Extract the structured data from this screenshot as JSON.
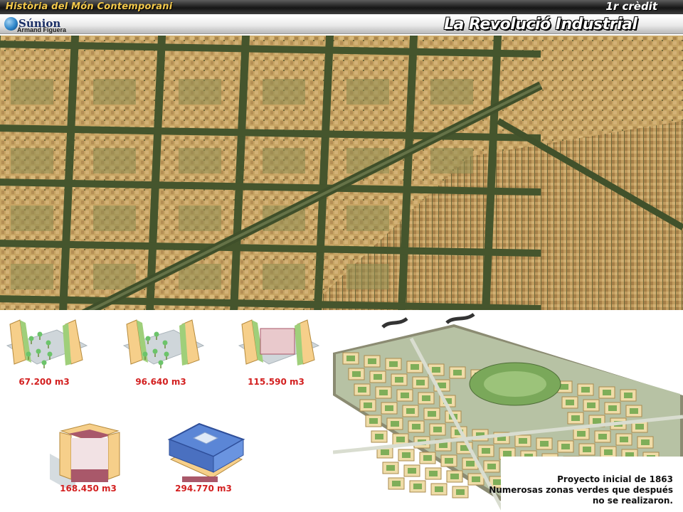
{
  "header": {
    "course_title": "Història del Món Contemporani",
    "credit": "1r crèdit",
    "lesson_title": "La Revolució Industrial",
    "logo": {
      "name": "Súnion",
      "author": "Armand Figuera",
      "icon": "globe-icon"
    }
  },
  "aerial_photo": {
    "subject": "aerial-view-city-grid",
    "colors": {
      "roofs": "#c8a765",
      "streets": "#4a5a30"
    }
  },
  "volume_diagram": {
    "blocks": [
      {
        "label": "67.200 m3",
        "type": "two-sides-garden"
      },
      {
        "label": "96.640 m3",
        "type": "two-sides-garden-wide"
      },
      {
        "label": "115.590 m3",
        "type": "two-sides-courtyard"
      },
      {
        "label": "168.450 m3",
        "type": "four-sides-open"
      },
      {
        "label": "294.770 m3",
        "type": "fully-built-closed"
      }
    ],
    "colors": {
      "label": "#d32020",
      "building": "#f6cf8a",
      "roof_blue": "#5b86d6",
      "court": "#a9586a"
    }
  },
  "plan_panel": {
    "caption_lines": [
      "Proyecto inicial de 1863",
      "Numerosas zonas verdes que después",
      "no se realizaron."
    ]
  }
}
